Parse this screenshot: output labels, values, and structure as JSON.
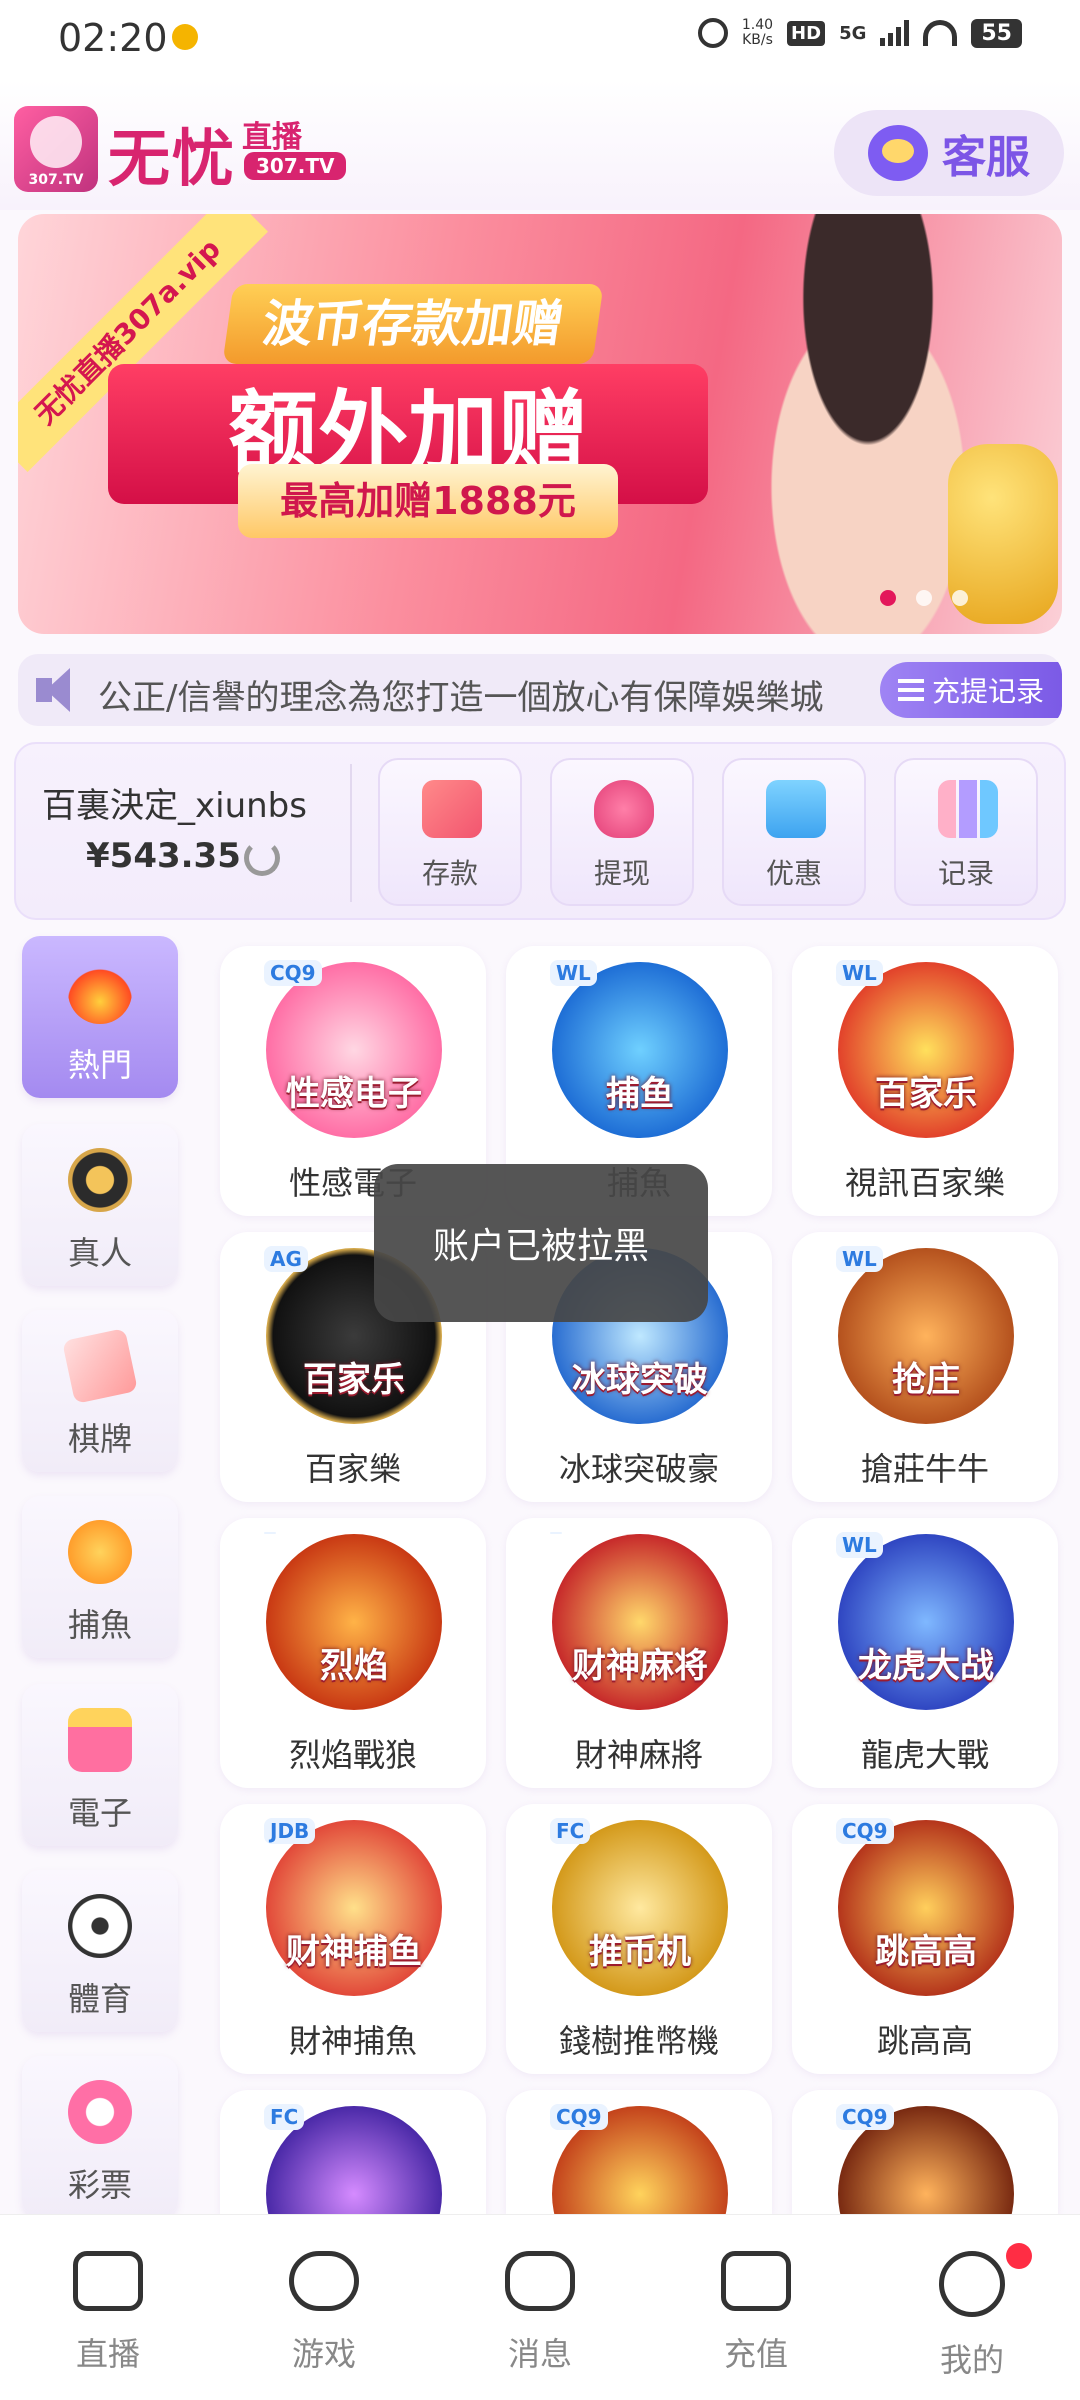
{
  "status_bar": {
    "time": "02:20",
    "speed_value": "1.40",
    "speed_unit": "KB/s",
    "hd_label": "HD",
    "network": "5G",
    "battery": "55"
  },
  "header": {
    "logo_badge": "307.TV",
    "logo_title": "无忧",
    "logo_sub": "直播",
    "logo_domain": "307.TV",
    "service_label": "客服"
  },
  "banner": {
    "ribbon": "无忧直播307a.vip",
    "title": "波币存款加赠",
    "main": "额外加赠",
    "sub": "最高加赠1888元"
  },
  "marquee": {
    "text": "公正/信譽的理念為您打造一個放心有保障娛樂城",
    "record_button": "充提记录"
  },
  "account": {
    "username": "百裏決定_xiunbs",
    "balance": "¥543.35",
    "actions": [
      {
        "label": "存款",
        "icon": "card-icon"
      },
      {
        "label": "提现",
        "icon": "money-bag-icon"
      },
      {
        "label": "优惠",
        "icon": "gift-icon"
      },
      {
        "label": "记录",
        "icon": "bar-chart-icon"
      }
    ]
  },
  "categories": [
    {
      "label": "熱門",
      "icon": "fire-icon",
      "active": true
    },
    {
      "label": "真人",
      "icon": "poker-chip-icon",
      "active": false
    },
    {
      "label": "棋牌",
      "icon": "playing-card-icon",
      "active": false
    },
    {
      "label": "捕魚",
      "icon": "fish-icon",
      "active": false
    },
    {
      "label": "電子",
      "icon": "slot-machine-icon",
      "active": false
    },
    {
      "label": "體育",
      "icon": "soccer-ball-icon",
      "active": false
    },
    {
      "label": "彩票",
      "icon": "lottery-ball-icon",
      "active": false
    }
  ],
  "games": [
    {
      "label": "性感電子",
      "badge": "CQ9",
      "art_text": "性感电子"
    },
    {
      "label": "捕魚",
      "badge": "WL",
      "art_text": "捕鱼"
    },
    {
      "label": "視訊百家樂",
      "badge": "WL",
      "art_text": "百家乐"
    },
    {
      "label": "百家樂",
      "badge": "AG",
      "art_text": "百家乐"
    },
    {
      "label": "冰球突破豪",
      "badge": "",
      "art_text": "冰球突破"
    },
    {
      "label": "搶莊牛牛",
      "badge": "WL",
      "art_text": "抢庄"
    },
    {
      "label": "烈焰戰狼",
      "badge": "",
      "art_text": "烈焰"
    },
    {
      "label": "財神麻將",
      "badge": "",
      "art_text": "财神麻将"
    },
    {
      "label": "龍虎大戰",
      "badge": "WL",
      "art_text": "龙虎大战"
    },
    {
      "label": "財神捕魚",
      "badge": "JDB",
      "art_text": "财神捕鱼"
    },
    {
      "label": "錢樹推幣機",
      "badge": "FC",
      "art_text": "推币机"
    },
    {
      "label": "跳高高",
      "badge": "CQ9",
      "art_text": "跳高高"
    },
    {
      "label": "",
      "badge": "FC",
      "art_text": ""
    },
    {
      "label": "",
      "badge": "CQ9",
      "art_text": ""
    },
    {
      "label": "",
      "badge": "CQ9",
      "art_text": ""
    }
  ],
  "toast": {
    "message": "账户已被拉黑"
  },
  "bottom_nav": [
    {
      "label": "直播",
      "icon": "camera-icon"
    },
    {
      "label": "游戏",
      "icon": "gamepad-icon"
    },
    {
      "label": "消息",
      "icon": "chat-icon"
    },
    {
      "label": "充值",
      "icon": "wallet-icon"
    },
    {
      "label": "我的",
      "icon": "smile-icon"
    }
  ],
  "colors": {
    "brand": "#d8246f",
    "accent_purple": "#7b5ae6",
    "toast_bg": "#464646",
    "background": "#fbf8fd"
  }
}
